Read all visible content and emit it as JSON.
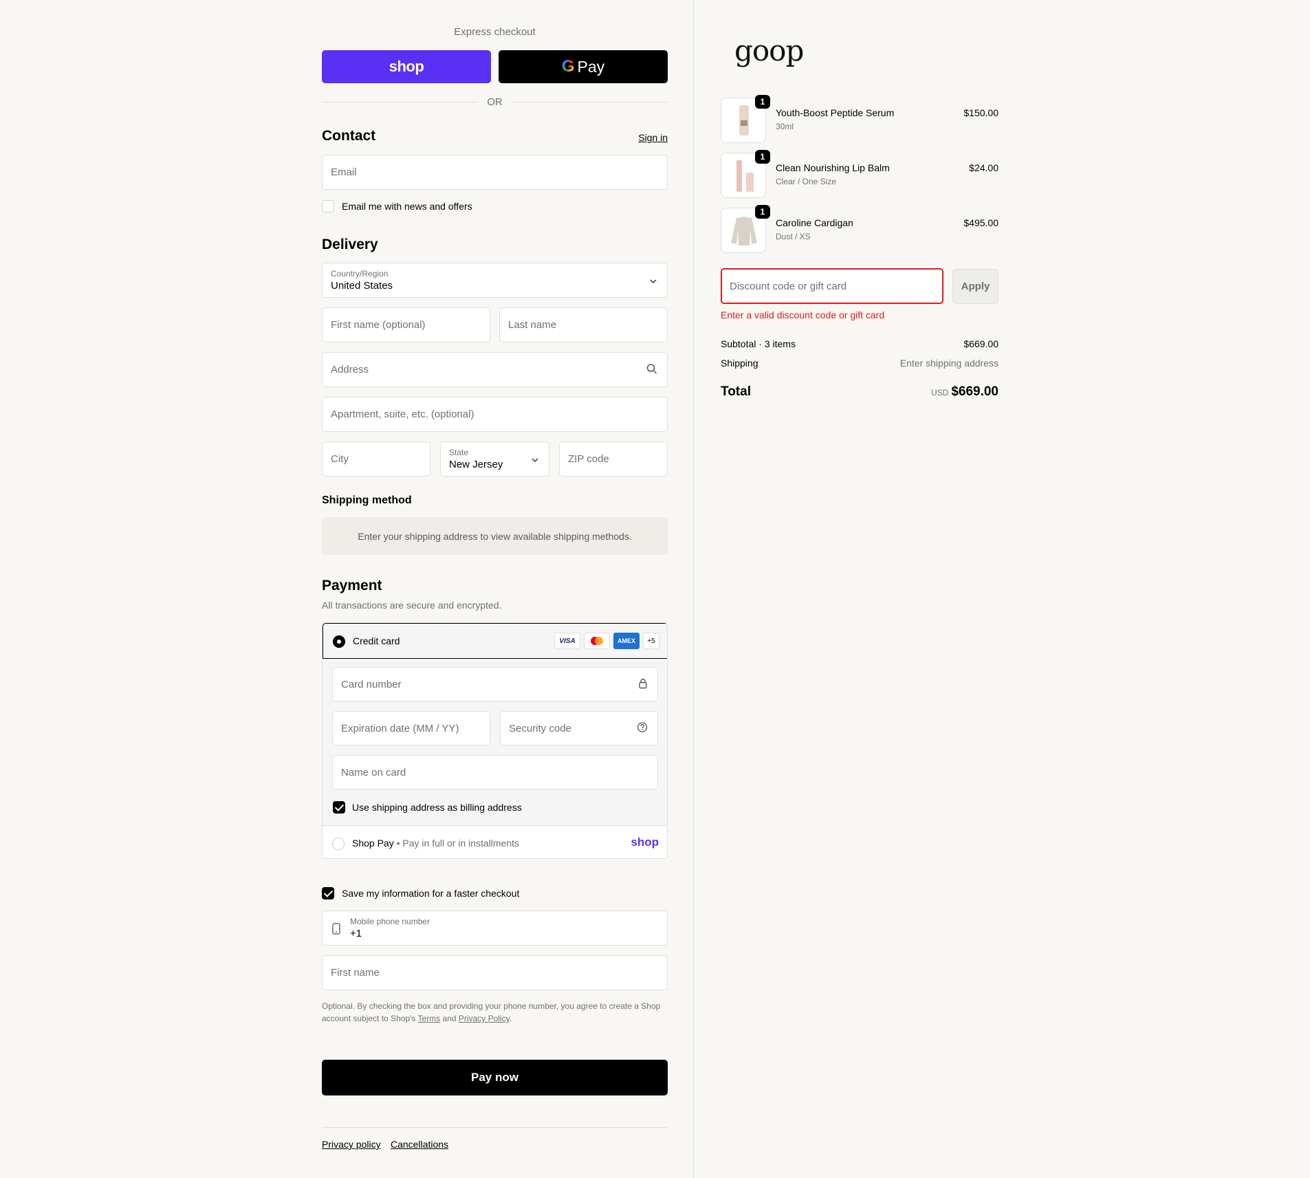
{
  "express": {
    "label": "Express checkout",
    "shop_label": "shop",
    "gpay_g": "G",
    "gpay_label": "Pay",
    "or_label": "OR"
  },
  "contact": {
    "title": "Contact",
    "sign_in": "Sign in",
    "email_placeholder": "Email",
    "news_label": "Email me with news and offers"
  },
  "delivery": {
    "title": "Delivery",
    "country_label": "Country/Region",
    "country_value": "United States",
    "first_name_placeholder": "First name (optional)",
    "last_name_placeholder": "Last name",
    "address_placeholder": "Address",
    "apartment_placeholder": "Apartment, suite, etc. (optional)",
    "city_placeholder": "City",
    "state_label": "State",
    "state_value": "New Jersey",
    "zip_placeholder": "ZIP code"
  },
  "shipping_method": {
    "title": "Shipping method",
    "message": "Enter your shipping address to view available shipping methods."
  },
  "payment": {
    "title": "Payment",
    "subtitle": "All transactions are secure and encrypted.",
    "credit_card_label": "Credit card",
    "brands": [
      "VISA",
      "",
      "AMEX",
      "+5"
    ],
    "card_number_placeholder": "Card number",
    "expiration_placeholder": "Expiration date (MM / YY)",
    "security_placeholder": "Security code",
    "name_placeholder": "Name on card",
    "billing_label": "Use shipping address as billing address",
    "shop_pay_label": "Shop Pay",
    "shop_pay_sub": "Pay in full or in installments",
    "shop_pay_logo": "shop"
  },
  "save_info": {
    "label": "Save my information for a faster checkout",
    "phone_label": "Mobile phone number",
    "phone_value": "+1",
    "first_name_placeholder": "First name",
    "legal_prefix": "Optional. By checking the box and providing your phone number, you agree to create a Shop account subject to Shop's",
    "terms": "Terms",
    "and": "and",
    "privacy": "Privacy Policy",
    "period": "."
  },
  "pay_now": "Pay now",
  "footer": {
    "privacy": "Privacy policy",
    "cancellations": "Cancellations"
  },
  "summary": {
    "logo": "goop",
    "items": [
      {
        "name": "Youth-Boost Peptide Serum",
        "variant": "30ml",
        "price": "$150.00",
        "qty": "1"
      },
      {
        "name": "Clean Nourishing Lip Balm",
        "variant": "Clear / One Size",
        "price": "$24.00",
        "qty": "1"
      },
      {
        "name": "Caroline Cardigan",
        "variant": "Dust / XS",
        "price": "$495.00",
        "qty": "1"
      }
    ],
    "discount_placeholder": "Discount code or gift card",
    "apply_label": "Apply",
    "error": "Enter a valid discount code or gift card",
    "subtotal_label": "Subtotal · 3 items",
    "subtotal_value": "$669.00",
    "shipping_label": "Shipping",
    "shipping_value": "Enter shipping address",
    "total_label": "Total",
    "currency": "USD",
    "total_value": "$669.00"
  },
  "colors": {
    "shop_purple": "#5a31f4",
    "error_red": "#dd1d1d"
  }
}
